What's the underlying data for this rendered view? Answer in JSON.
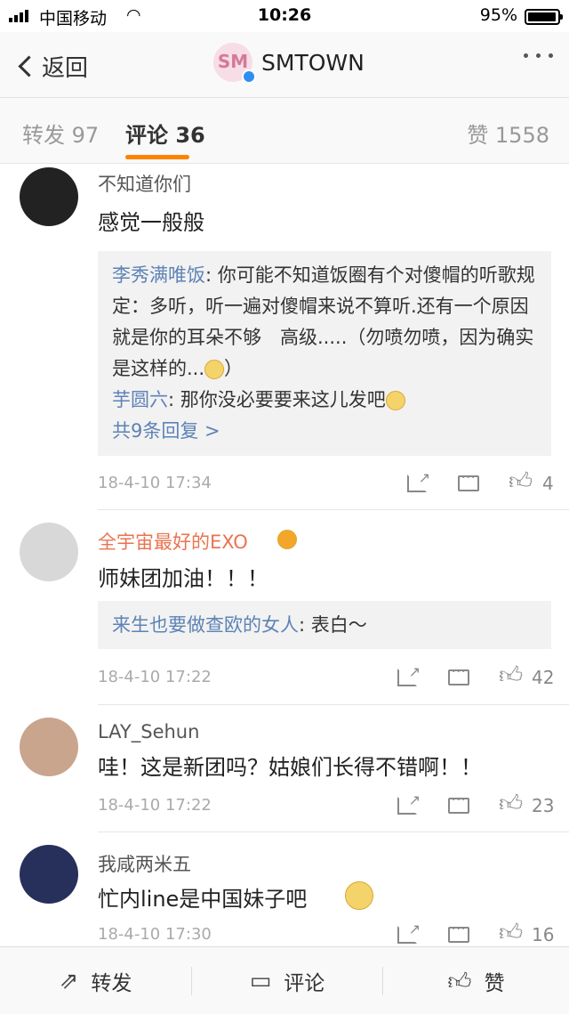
{
  "status": {
    "carrier": "中国移动",
    "time": "10:26",
    "battery": "95%"
  },
  "nav": {
    "back_label": "返回",
    "title": "SMTOWN",
    "logo_text": "SM"
  },
  "tabs": {
    "repost": "转发 97",
    "comment": "评论 36",
    "like": "赞 1558"
  },
  "comments": [
    {
      "user": "不知道你们",
      "text": "感觉一般般",
      "replies": [
        {
          "name": "李秀满唯饭",
          "text": ": 你可能不知道饭圈有个对傻帽的听歌规定：多听，听一遍对傻帽来说不算听.还有一个原因就是你的耳朵不够　高级.....（勿喷勿喷，因为确实是这样的..."
        },
        {
          "name": "芋圆六",
          "text": ": 那你没必要要来这儿发吧"
        }
      ],
      "more_replies": "共9条回复 >",
      "time": "18-4-10 17:34",
      "likes": "4"
    },
    {
      "user": "全宇宙最好的EXO",
      "text": "师妹团加油！！！",
      "replies": [
        {
          "name": "来生也要做查欧的女人",
          "text": ": 表白～"
        }
      ],
      "time": "18-4-10 17:22",
      "likes": "42"
    },
    {
      "user": "LAY_Sehun",
      "text": "哇！这是新团吗？姑娘们长得不错啊！！",
      "time": "18-4-10 17:22",
      "likes": "23"
    },
    {
      "user": "我咸两米五",
      "text": "忙内line是中国妹子吧",
      "time": "18-4-10 17:30",
      "likes": "16"
    }
  ],
  "bottom": {
    "repost": "转发",
    "comment": "评论",
    "like": "赞"
  }
}
